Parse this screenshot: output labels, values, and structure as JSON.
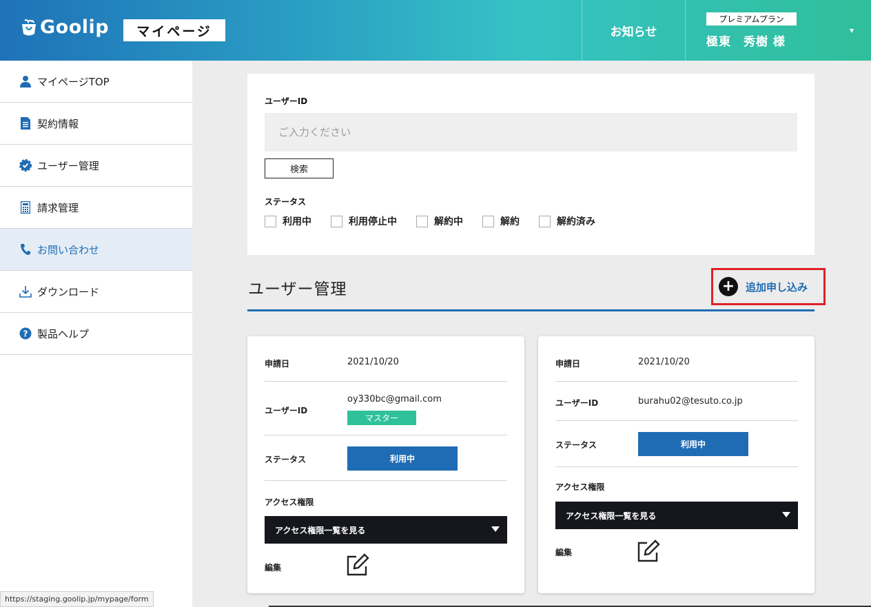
{
  "header": {
    "logo_text": "Goolip",
    "mypage_label": "マイページ",
    "notice_label": "お知らせ",
    "plan_label": "プレミアムプラン",
    "user_name": "極東　秀樹 様",
    "colors": {
      "gradient_start": "#1f72b8",
      "gradient_end": "#2fbf9a"
    }
  },
  "sidebar": {
    "items": [
      {
        "label": "マイページTOP",
        "icon": "user-icon"
      },
      {
        "label": "契約情報",
        "icon": "document-icon"
      },
      {
        "label": "ユーザー管理",
        "icon": "gear-check-icon"
      },
      {
        "label": "請求管理",
        "icon": "calculator-icon"
      },
      {
        "label": "お問い合わせ",
        "icon": "phone-icon",
        "active": true
      },
      {
        "label": "ダウンロード",
        "icon": "download-icon"
      },
      {
        "label": "製品ヘルプ",
        "icon": "help-icon"
      }
    ]
  },
  "search": {
    "userid_label": "ユーザーID",
    "placeholder": "ご入力ください",
    "search_button": "検索",
    "status_label": "ステータス",
    "statuses": [
      "利用中",
      "利用停止中",
      "解約中",
      "解約",
      "解約済み"
    ]
  },
  "section": {
    "title": "ユーザー管理",
    "add_button": "追加申し込み"
  },
  "cards": [
    {
      "date_label": "申請日",
      "date": "2021/10/20",
      "userid_label": "ユーザーID",
      "userid": "oy330bc@gmail.com",
      "badge": "マスター",
      "status_label": "ステータス",
      "status": "利用中",
      "access_label": "アクセス権限",
      "access_button": "アクセス権限一覧を見る",
      "edit_label": "編集"
    },
    {
      "date_label": "申請日",
      "date": "2021/10/20",
      "userid_label": "ユーザーID",
      "userid": "burahu02@tesuto.co.jp",
      "status_label": "ステータス",
      "status": "利用中",
      "access_label": "アクセス権限",
      "access_button": "アクセス権限一覧を見る",
      "edit_label": "編集"
    }
  ],
  "status_bar": {
    "url": "https://staging.goolip.jp/mypage/form"
  }
}
